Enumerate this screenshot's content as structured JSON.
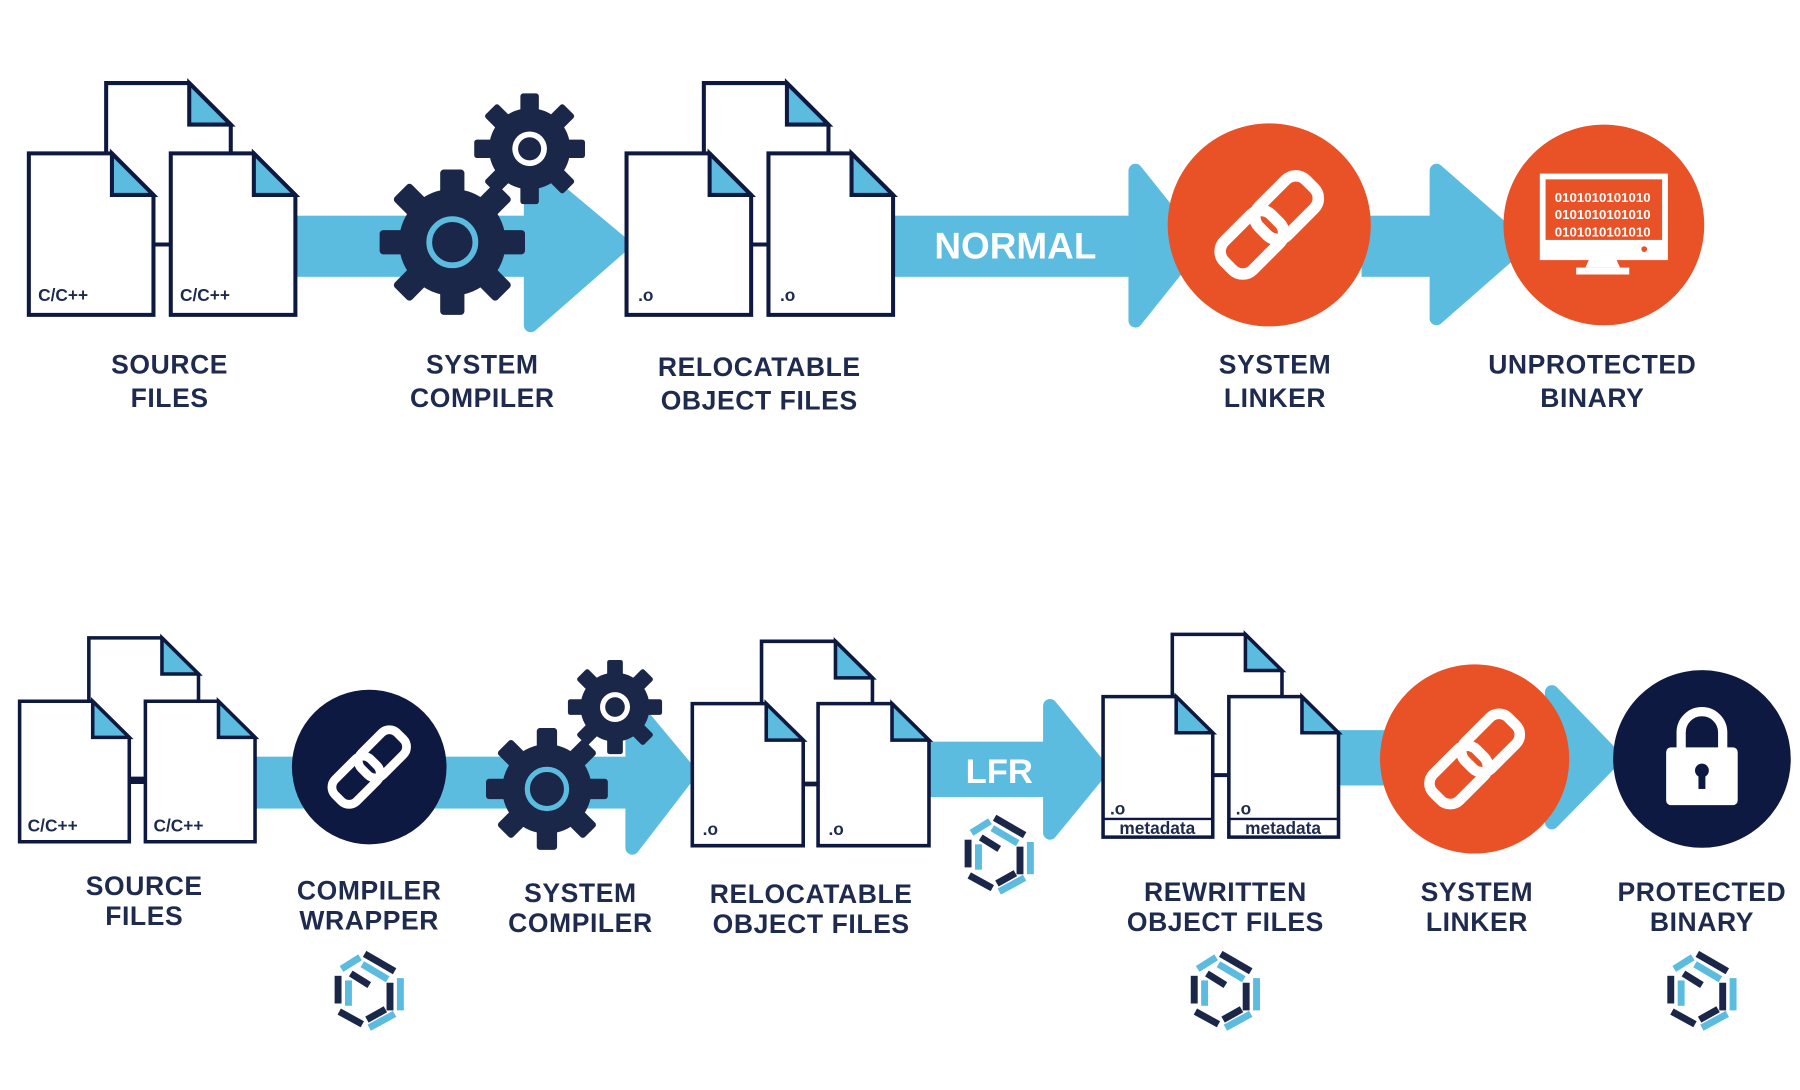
{
  "colors": {
    "navy": "#1b2748",
    "dark_circle": "#0d1940",
    "blue": "#5bbce0",
    "orange": "#e85226",
    "white": "#ffffff"
  },
  "normal_flow": {
    "band_label": "NORMAL",
    "doc_labels": {
      "source": "C/C++",
      "object": ".o"
    },
    "binary_text": [
      "0101010101010",
      "0101010101010",
      "0101010101010"
    ],
    "steps": [
      {
        "line1": "SOURCE",
        "line2": "FILES"
      },
      {
        "line1": "SYSTEM",
        "line2": "COMPILER"
      },
      {
        "line1": "RELOCATABLE",
        "line2": "OBJECT FILES"
      },
      {
        "line1": "SYSTEM",
        "line2": "LINKER"
      },
      {
        "line1": "UNPROTECTED",
        "line2": "BINARY"
      }
    ]
  },
  "lfr_flow": {
    "band_label": "LFR",
    "doc_labels": {
      "source": "C/C++",
      "object": ".o",
      "metadata": "metadata"
    },
    "steps": [
      {
        "line1": "SOURCE",
        "line2": "FILES"
      },
      {
        "line1": "COMPILER",
        "line2": "WRAPPER"
      },
      {
        "line1": "SYSTEM",
        "line2": "COMPILER"
      },
      {
        "line1": "RELOCATABLE",
        "line2": "OBJECT FILES"
      },
      {
        "line1": "REWRITTEN",
        "line2": "OBJECT FILES"
      },
      {
        "line1": "SYSTEM",
        "line2": "LINKER"
      },
      {
        "line1": "PROTECTED",
        "line2": "BINARY"
      }
    ]
  }
}
